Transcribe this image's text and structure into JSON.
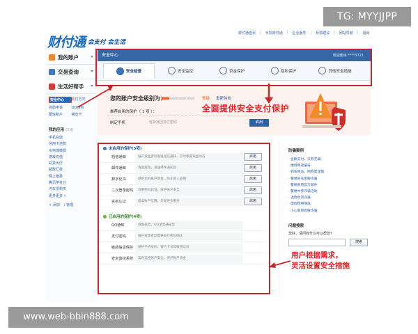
{
  "badge": "TG: MYYJJPP",
  "watermark": "www.web-bbin888.com",
  "logo": {
    "mark": "财付通",
    "slogan": "会支付 会生活"
  },
  "topnav": [
    "财付通首页",
    "手机财付通",
    "企业服务",
    "反馈建议",
    "网站导航",
    "退出"
  ],
  "sidebar": {
    "items": [
      {
        "label": "我的账户",
        "color": "#e7892d"
      },
      {
        "label": "交易查询",
        "color": "#3f7bc1"
      },
      {
        "label": "生活好帮手",
        "color": "#d23d3d"
      }
    ],
    "links": [
      "安全中心",
      "支付方式",
      "自助申诉",
      "QQ钱包",
      "跟班账户",
      "绑定卡"
    ],
    "apps_header": "我的应用",
    "apps_count": "(10)",
    "apps": [
      "手机充值",
      "信用卡还款",
      "水电煤缴费",
      "游戏充值",
      "彩票大厅",
      "邮政汇款",
      "网上缴费",
      "腾讯学社分",
      "汽车票购买",
      "更多更多 »"
    ],
    "apps_footer": [
      "+ 添加",
      "/ 管理"
    ]
  },
  "main": {
    "bar_title": "安全中心",
    "bar_user": "欢迎使用 ****3721",
    "tabs": [
      "安全检查",
      "安全监控",
      "资金保护",
      "隐私保护",
      "其他安全措施"
    ],
    "security": {
      "title": "您的账户安全级别为：",
      "level": "低级",
      "recheck": "重新体检",
      "recommend": "推荐启用的保护（ 1 项 ）：",
      "phone_name": "绑定手机",
      "phone_desc": "轻松找回支付密码",
      "enable": "启用"
    },
    "callout1": "全面提供安全支付保护",
    "unprotected_header": "未启用的保护(5项)",
    "unprotected": [
      {
        "name": "短信通知",
        "desc": "账户资金变动发送短信通知，实时掌握资金动态",
        "btn": "启用"
      },
      {
        "name": "邮件通知",
        "desc": "资金变动，发送邮件通知您",
        "btn": "启用"
      },
      {
        "name": "数字证书",
        "desc": "保护您的账户资金，防止他人盗用",
        "btn": "启用"
      },
      {
        "name": "二次登录密码",
        "desc": "双重密码验证，保护账户安全",
        "btn": "启用"
      },
      {
        "name": "实名认证",
        "desc": "提高账户信用，享受更多服务",
        "btn": "启用"
      }
    ],
    "protected_header": "已启用的保护(4项)",
    "protected": [
      {
        "name": "QQ通知",
        "desc": "资金变动，QQ消息通知您"
      },
      {
        "name": "支付密码",
        "desc": "账户资金变动需要支付密码确认"
      },
      {
        "name": "敏感信息保护",
        "desc": "保护手机号码、银行卡号等敏感信息"
      },
      {
        "name": "安全监控系统",
        "desc": "实时监控账户安全，保护账户资金"
      }
    ],
    "callout2": [
      "用户根据需求，",
      "灵活设置安全措施"
    ]
  },
  "right": {
    "header": "防骗案例",
    "items": [
      "全额支付，只有无骗",
      "虚假网店骗局",
      "钓鱼网站，网购需谨慎",
      "警惕冒充客服诈骗",
      "警惕假冒官方邮件",
      "警惕中奖诈骗活动",
      "退款退货诈骗",
      "虚假购物网站",
      "小心假冒客服诈骗"
    ],
    "header2": "问题搜索",
    "question": "您好，请问有什么可以帮您？",
    "search_btn": "搜索"
  }
}
